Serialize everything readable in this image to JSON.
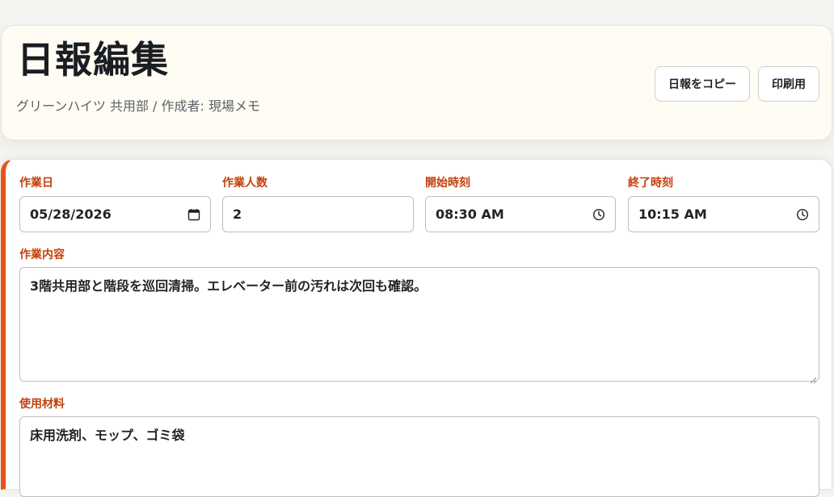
{
  "header": {
    "title": "日報編集",
    "subtitle": "グリーンハイツ 共用部 / 作成者: 現場メモ",
    "copy_button": "日報をコピー",
    "print_button": "印刷用"
  },
  "form": {
    "work_date": {
      "label": "作業日",
      "value": "05/28/2026",
      "icon": "calendar-icon"
    },
    "workers": {
      "label": "作業人数",
      "value": "2"
    },
    "start_time": {
      "label": "開始時刻",
      "value": "08:30 AM",
      "icon": "clock-icon"
    },
    "end_time": {
      "label": "終了時刻",
      "value": "10:15 AM",
      "icon": "clock-icon"
    },
    "work_content": {
      "label": "作業内容",
      "value": "3階共用部と階段を巡回清掃。エレベーター前の汚れは次回も確認。"
    },
    "materials": {
      "label": "使用材料",
      "value": "床用洗剤、モップ、ゴミ袋"
    }
  },
  "colors": {
    "accent": "#e8521c",
    "label": "#c2410c",
    "header_bg": "#fffcf3"
  }
}
